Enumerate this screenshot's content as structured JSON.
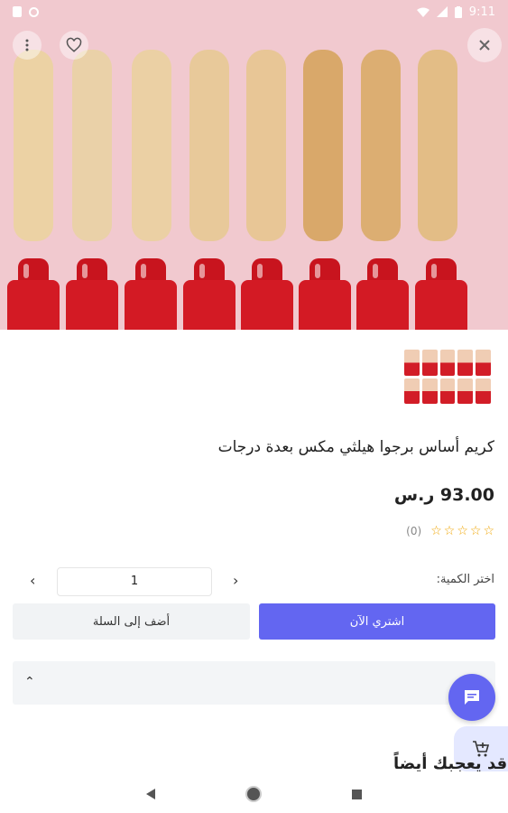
{
  "status_bar": {
    "time": "9:11"
  },
  "product": {
    "title": "كريم أساس برجوا هيلثي مكس بعدة درجات",
    "price": "93.00 ر.س",
    "rating_count": "(0)",
    "stars": [
      "☆",
      "☆",
      "☆",
      "☆",
      "☆"
    ]
  },
  "quantity": {
    "label": "اختر الكمية:",
    "value": "1"
  },
  "buttons": {
    "buy_now": "اشتري الآن",
    "add_to_cart": "أضف إلى السلة"
  },
  "section": {
    "title": "قد يعجبك أيضاً"
  },
  "colors": {
    "accent": "#6366f1",
    "hero_bg": "#f1c9cf",
    "bottle_red": "#d31a24"
  },
  "icons": [
    "menu-dots-icon",
    "heart-icon",
    "close-icon",
    "chat-icon",
    "cart-add-icon",
    "back-nav-icon",
    "home-nav-icon",
    "recent-apps-icon"
  ]
}
